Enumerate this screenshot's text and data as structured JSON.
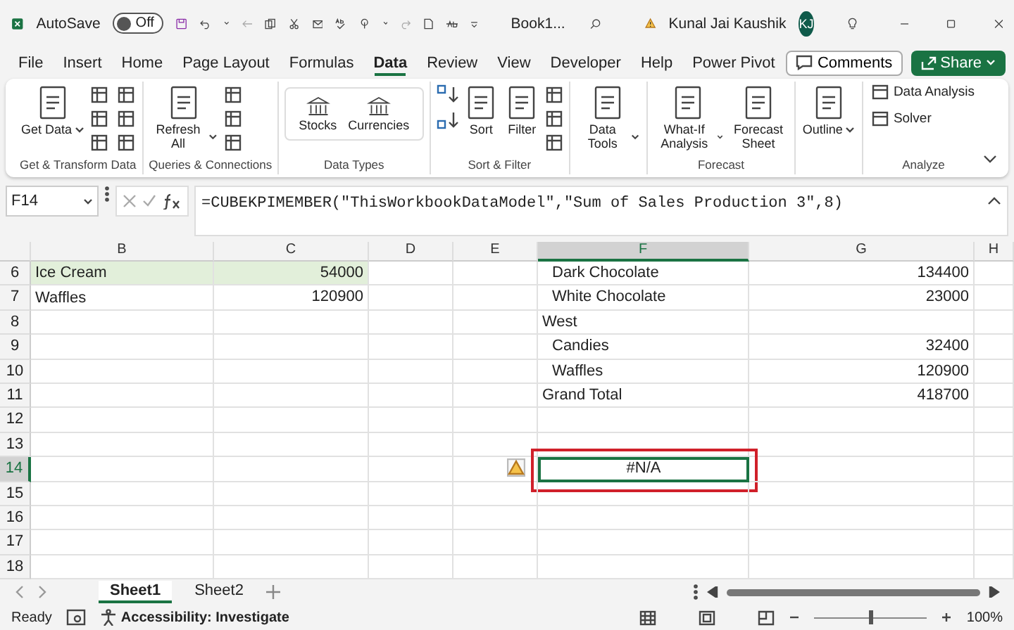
{
  "title_bar": {
    "autosave_label": "AutoSave",
    "autosave": {
      "on": false,
      "label": "Off"
    },
    "document": "Book1...",
    "user": "Kunal Jai Kaushik",
    "avatar": "KJ"
  },
  "tabs": [
    {
      "label": "File",
      "selected": false
    },
    {
      "label": "Insert",
      "selected": false
    },
    {
      "label": "Home",
      "selected": false
    },
    {
      "label": "Page Layout",
      "selected": false
    },
    {
      "label": "Formulas",
      "selected": false
    },
    {
      "label": "Data",
      "selected": true
    },
    {
      "label": "Review",
      "selected": false
    },
    {
      "label": "View",
      "selected": false
    },
    {
      "label": "Developer",
      "selected": false
    },
    {
      "label": "Help",
      "selected": false
    },
    {
      "label": "Power Pivot",
      "selected": false
    }
  ],
  "comments_button": "Comments",
  "share_button": "Share",
  "ribbon": {
    "groups": [
      {
        "label": "Get & Transform Data",
        "items": [
          {
            "kind": "large",
            "label": "Get Data",
            "dropdown": true
          },
          {
            "kind": "icon-grid"
          }
        ]
      },
      {
        "label": "Queries & Connections",
        "items": [
          {
            "kind": "large",
            "label": "Refresh All",
            "dropdown": true
          },
          {
            "kind": "icon-column"
          }
        ]
      },
      {
        "label": "Data Types",
        "items": [
          {
            "kind": "gallery",
            "label": "Stocks"
          },
          {
            "kind": "gallery",
            "label": "Currencies"
          }
        ]
      },
      {
        "label": "Sort & Filter",
        "items": [
          {
            "kind": "sortpair"
          },
          {
            "kind": "large",
            "label": "Sort",
            "dropdown": false
          },
          {
            "kind": "large",
            "label": "Filter",
            "dropdown": false
          },
          {
            "kind": "icon-column"
          }
        ]
      },
      {
        "items": [
          {
            "kind": "large",
            "label": "Data Tools",
            "dropdown": true
          }
        ]
      },
      {
        "label": "Forecast",
        "items": [
          {
            "kind": "large",
            "label": "What-If Analysis",
            "dropdown": true
          },
          {
            "kind": "large",
            "label": "Forecast Sheet",
            "dropdown": false
          }
        ]
      },
      {
        "items": [
          {
            "kind": "large",
            "label": "Outline",
            "dropdown": true
          }
        ]
      },
      {
        "label": "Analyze",
        "items": [
          {
            "kind": "small",
            "label": "Data Analysis"
          },
          {
            "kind": "small",
            "label": "Solver"
          }
        ]
      }
    ]
  },
  "formula_bar": {
    "name_box": "F14",
    "formula": "=CUBEKPIMEMBER(\"ThisWorkbookDataModel\",\"Sum of Sales Production 3\",8)"
  },
  "columns": [
    {
      "label": "B",
      "selected": false
    },
    {
      "label": "C",
      "selected": false
    },
    {
      "label": "D",
      "selected": false
    },
    {
      "label": "E",
      "selected": false
    },
    {
      "label": "F",
      "selected": true
    },
    {
      "label": "G",
      "selected": false
    },
    {
      "label": "H",
      "selected": false
    }
  ],
  "rows": [
    {
      "number": "6",
      "selected": false,
      "cells": {
        "b": {
          "kind": "label",
          "text": "Ice Cream",
          "highlight": true
        },
        "c": {
          "kind": "number",
          "text": "54000",
          "highlight": true
        },
        "f": {
          "kind": "item",
          "text": "Dark Chocolate"
        },
        "g": {
          "kind": "number",
          "text": "134400"
        }
      }
    },
    {
      "number": "7",
      "selected": false,
      "cells": {
        "b": {
          "kind": "label",
          "text": "Waffles"
        },
        "c": {
          "kind": "number",
          "text": "120900"
        },
        "f": {
          "kind": "item",
          "text": "White Chocolate"
        },
        "g": {
          "kind": "number",
          "text": "23000"
        }
      }
    },
    {
      "number": "8",
      "selected": false,
      "cells": {
        "f": {
          "kind": "label",
          "text": "West"
        }
      }
    },
    {
      "number": "9",
      "selected": false,
      "cells": {
        "f": {
          "kind": "item",
          "text": "Candies"
        },
        "g": {
          "kind": "number",
          "text": "32400"
        }
      }
    },
    {
      "number": "10",
      "selected": false,
      "cells": {
        "f": {
          "kind": "item",
          "text": "Waffles"
        },
        "g": {
          "kind": "number",
          "text": "120900"
        }
      }
    },
    {
      "number": "11",
      "selected": false,
      "cells": {
        "f": {
          "kind": "label",
          "text": "Grand Total"
        },
        "g": {
          "kind": "number",
          "text": "418700"
        }
      }
    },
    {
      "number": "12",
      "selected": false,
      "cells": {}
    },
    {
      "number": "13",
      "selected": false,
      "cells": {}
    },
    {
      "number": "14",
      "selected": true,
      "warning": true,
      "cells": {
        "f": {
          "kind": "error",
          "text": "#N/A",
          "selected": true,
          "annotated": true
        }
      }
    },
    {
      "number": "15",
      "selected": false,
      "cells": {}
    },
    {
      "number": "16",
      "selected": false,
      "cells": {}
    },
    {
      "number": "17",
      "selected": false,
      "cells": {}
    },
    {
      "number": "18",
      "selected": false,
      "cells": {}
    }
  ],
  "sheets": [
    {
      "label": "Sheet1",
      "selected": true
    },
    {
      "label": "Sheet2",
      "selected": false
    }
  ],
  "status_bar": {
    "mode": "Ready",
    "accessibility": "Accessibility: Investigate",
    "zoom": {
      "level": 0.5,
      "label": "100%"
    }
  }
}
